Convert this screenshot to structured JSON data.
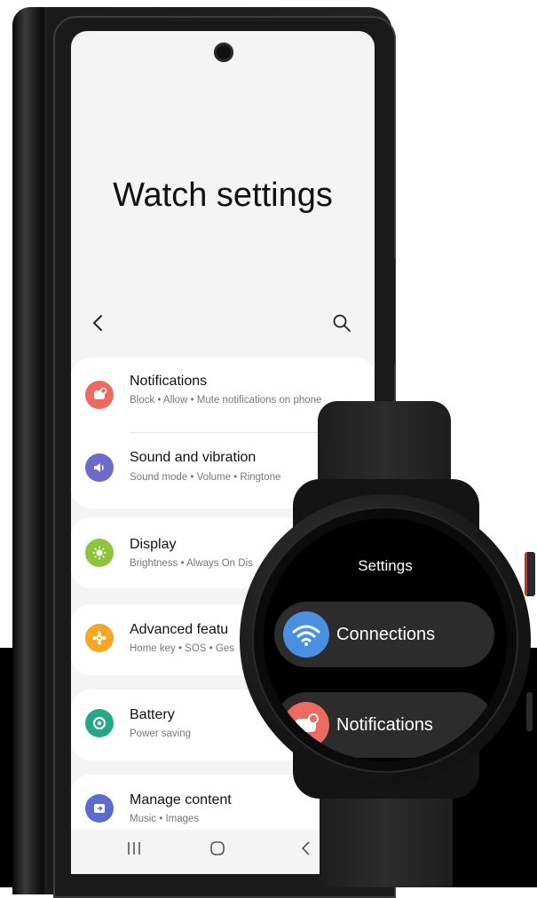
{
  "phone": {
    "title": "Watch settings",
    "items": [
      {
        "label": "Notifications",
        "sub": "Block • Allow • Mute notifications on phone",
        "icon": "notifications-icon",
        "color": "#ef6a5e"
      },
      {
        "label": "Sound and vibration",
        "sub": "Sound mode • Volume • Ringtone",
        "icon": "sound-icon",
        "color": "#6c6acb"
      },
      {
        "label": "Display",
        "sub": "Brightness • Always On Dis",
        "icon": "display-icon",
        "color": "#8cc43c"
      },
      {
        "label": "Advanced featu",
        "sub": "Home key • SOS • Ges",
        "icon": "advanced-features-icon",
        "color": "#f5a623"
      },
      {
        "label": "Battery",
        "sub": "Power saving",
        "icon": "battery-icon",
        "color": "#25a88a"
      },
      {
        "label": "Manage content",
        "sub": "Music • Images",
        "icon": "manage-content-icon",
        "color": "#5b6bd0"
      }
    ]
  },
  "watch": {
    "title": "Settings",
    "items": [
      {
        "label": "Connections",
        "icon": "wifi-icon",
        "color": "#4a90e2"
      },
      {
        "label": "Notifications",
        "icon": "notifications-icon",
        "color": "#ef6a5e"
      }
    ]
  }
}
